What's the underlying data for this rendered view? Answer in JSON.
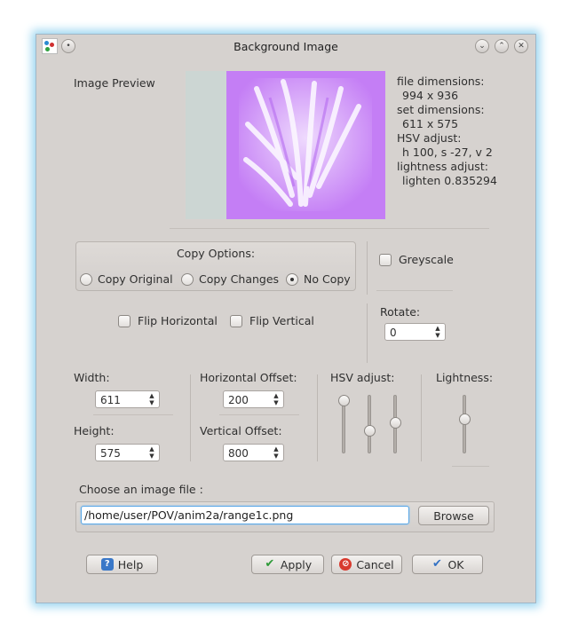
{
  "window": {
    "title": "Background Image"
  },
  "preview": {
    "label": "Image Preview",
    "info_lines": [
      "file dimensions:",
      "  994 x 936",
      "set dimensions:",
      "  611 x 575",
      "HSV adjust:",
      "  h 100, s -27, v 2",
      "lightness adjust:",
      "  lighten 0.835294"
    ]
  },
  "copy_options": {
    "title": "Copy Options:",
    "options": [
      "Copy Original",
      "Copy Changes",
      "No Copy"
    ],
    "selected": "No Copy"
  },
  "greyscale": {
    "label": "Greyscale",
    "checked": false
  },
  "flip": {
    "horizontal": {
      "label": "Flip Horizontal",
      "checked": false
    },
    "vertical": {
      "label": "Flip Vertical",
      "checked": false
    }
  },
  "rotate": {
    "label": "Rotate:",
    "value": "0"
  },
  "size": {
    "width_label": "Width:",
    "width_value": "611",
    "height_label": "Height:",
    "height_value": "575"
  },
  "offset": {
    "h_label": "Horizontal Offset:",
    "h_value": "200",
    "v_label": "Vertical Offset:",
    "v_value": "800"
  },
  "hsv": {
    "label": "HSV adjust:",
    "h_level": 1.0,
    "s_level": 0.35,
    "v_level": 0.52
  },
  "lightness": {
    "label": "Lightness:",
    "level": 0.6
  },
  "file": {
    "label": "Choose an image file :",
    "path": "/home/user/POV/anim2a/range1c.png",
    "browse_label": "Browse"
  },
  "buttons": {
    "help": "Help",
    "apply": "Apply",
    "cancel": "Cancel",
    "ok": "OK"
  },
  "colors": {
    "preview_left": "#ccd6d3",
    "preview_tint": "#c47ef5",
    "focus": "#5aa7e6"
  }
}
